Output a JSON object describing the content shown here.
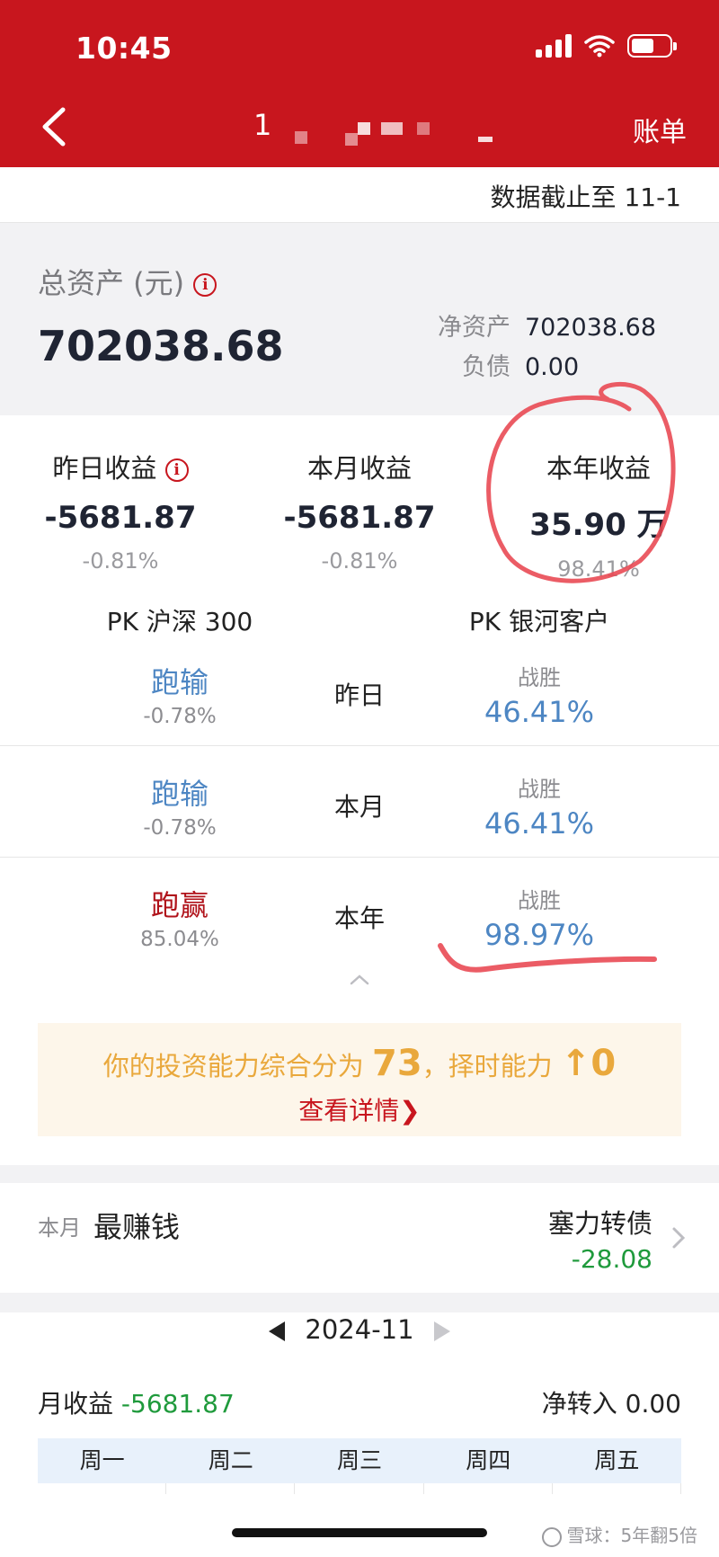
{
  "status_bar": {
    "time": "10:45"
  },
  "nav": {
    "title": "1",
    "right_label": "账单"
  },
  "cutoff": {
    "text": "数据截止至 11-1"
  },
  "assets": {
    "label": "总资产 (元)",
    "total": "702038.68",
    "net_label": "净资产",
    "net_value": "702038.68",
    "debt_label": "负债",
    "debt_value": "0.00"
  },
  "stats": [
    {
      "title": "昨日收益",
      "value": "-5681.87",
      "pct": "-0.81%"
    },
    {
      "title": "本月收益",
      "value": "-5681.87",
      "pct": "-0.81%"
    },
    {
      "title": "本年收益",
      "value": "35.90 万",
      "pct": "98.41%"
    }
  ],
  "pk": {
    "left_head": "PK 沪深 300",
    "right_head": "PK 银河客户",
    "rows": [
      {
        "result": "跑输",
        "index_pct": "-0.78%",
        "period": "昨日",
        "right_label": "战胜",
        "right_pct": "46.41%"
      },
      {
        "result": "跑输",
        "index_pct": "-0.78%",
        "period": "本月",
        "right_label": "战胜",
        "right_pct": "46.41%"
      },
      {
        "result": "跑赢",
        "index_pct": "85.04%",
        "period": "本年",
        "right_label": "战胜",
        "right_pct": "98.97%"
      }
    ]
  },
  "score": {
    "prefix": "你的投资能力综合分为 ",
    "score": "73",
    "middle": "，择时能力 ",
    "timing": "↑0",
    "link": "查看详情"
  },
  "earn": {
    "period": "本月",
    "title": "最赚钱",
    "name": "塞力转债",
    "value": "-28.08"
  },
  "month": {
    "label": "2024-11",
    "income_label": "月收益 ",
    "income_value": "-5681.87",
    "transfer_label": "净转入 ",
    "transfer_value": "0.00"
  },
  "weekdays": [
    "周一",
    "周二",
    "周三",
    "周四",
    "周五"
  ],
  "watermark": "雪球：5年翻5倍",
  "colors": {
    "brand_red": "#c8161e",
    "gain_green": "#1f9a3c",
    "link_blue": "#4d86c3",
    "score_orange": "#e9a83c"
  }
}
